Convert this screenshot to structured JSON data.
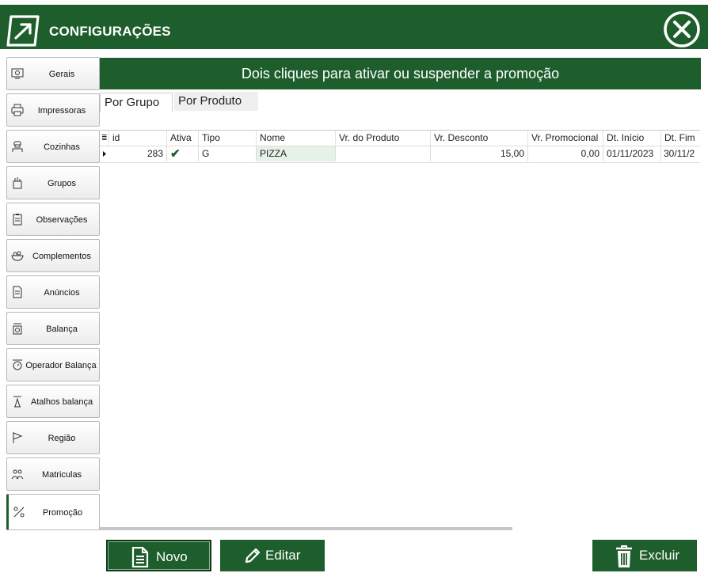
{
  "header": {
    "title": "CONFIGURAÇÕES"
  },
  "sidebar": {
    "items": [
      {
        "label": "Gerais",
        "icon": "monitor-gear-icon"
      },
      {
        "label": "Impressoras",
        "icon": "printer-icon"
      },
      {
        "label": "Cozinhas",
        "icon": "chef-icon"
      },
      {
        "label": "Grupos",
        "icon": "group-icon"
      },
      {
        "label": "Observações",
        "icon": "clipboard-icon"
      },
      {
        "label": "Complementos",
        "icon": "bowl-icon"
      },
      {
        "label": "Anúncios",
        "icon": "document-icon"
      },
      {
        "label": "Balança",
        "icon": "scale-icon"
      },
      {
        "label": "Operador Balança",
        "icon": "scale-operator-icon"
      },
      {
        "label": "Atalhos balança",
        "icon": "scale-shortcut-icon"
      },
      {
        "label": "Região",
        "icon": "flag-icon"
      },
      {
        "label": "Matriculas",
        "icon": "people-icon"
      },
      {
        "label": "Promoção",
        "icon": "promotion-icon"
      }
    ],
    "active": "Promoção"
  },
  "banner": "Dois cliques para ativar ou suspender a promoção",
  "tabs": [
    {
      "label": "Por Grupo",
      "active": true
    },
    {
      "label": "Por Produto",
      "active": false
    }
  ],
  "grid": {
    "columns": [
      "id",
      "Ativa",
      "Tipo",
      "Nome",
      "Vr. do Produto",
      "Vr. Desconto",
      "Vr. Promocional",
      "Dt. Início",
      "Dt. Fim"
    ],
    "rows": [
      {
        "id": "283",
        "ativa": "✔",
        "tipo": "G",
        "nome": "PIZZA",
        "vr_produto": "",
        "vr_desconto": "15,00",
        "vr_promocional": "0,00",
        "dt_inicio": "01/11/2023",
        "dt_fim": "30/11/2"
      }
    ]
  },
  "buttons": {
    "novo": "Novo",
    "editar": "Editar",
    "excluir": "Excluir"
  },
  "colors": {
    "primary": "#1e5e2c",
    "selected_cell": "#e6f2e7"
  }
}
